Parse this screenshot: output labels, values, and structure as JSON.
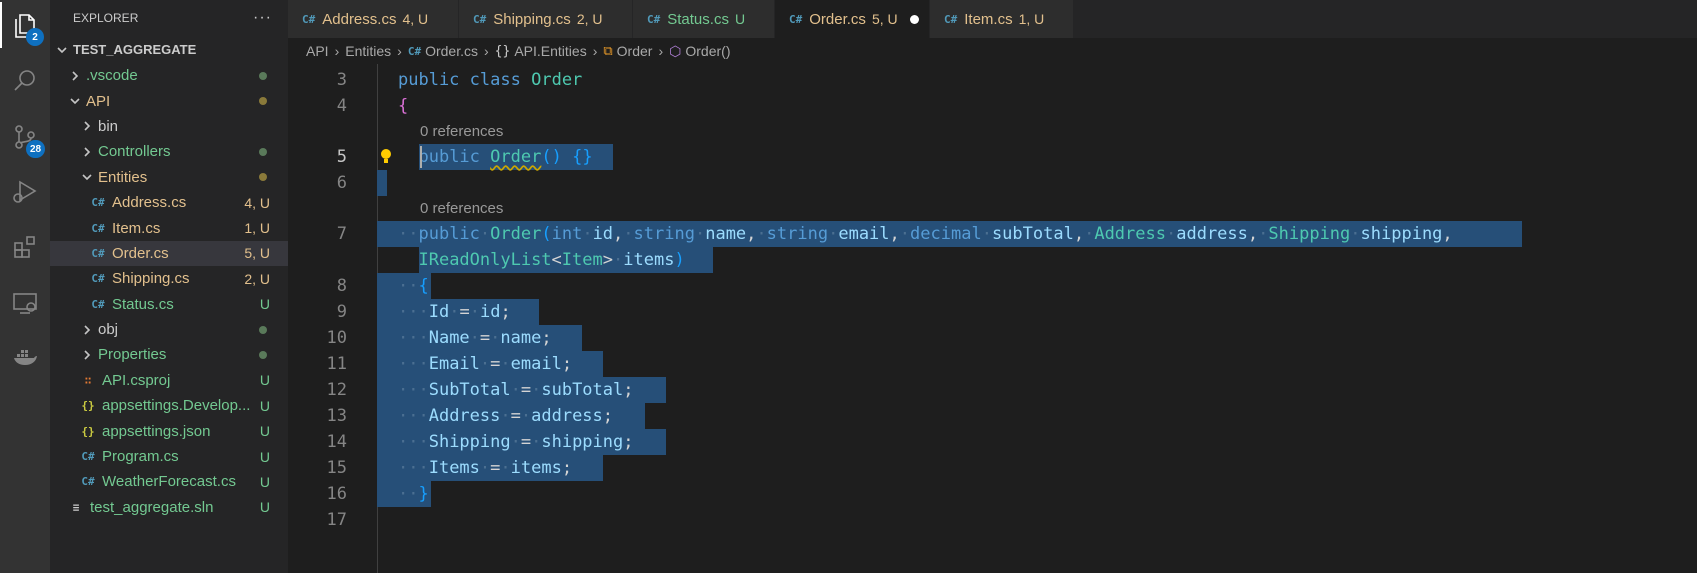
{
  "activity": {
    "explorer_badge": "2",
    "scm_badge": "28"
  },
  "sidebar": {
    "title": "EXPLORER",
    "more": "···",
    "root": "TEST_AGGREGATE",
    "items": [
      {
        "label": ".vscode",
        "kind": "folder",
        "open": false,
        "level": 1,
        "color": "#73c991",
        "marker": "dot",
        "marker_color": "#5a7a5a"
      },
      {
        "label": "API",
        "kind": "folder",
        "open": true,
        "level": 1,
        "color": "#e2c08d",
        "marker": "dot",
        "marker_color": "#8a7a3a"
      },
      {
        "label": "bin",
        "kind": "folder",
        "open": false,
        "level": 2,
        "color": "#cccccc",
        "marker": "",
        "marker_color": ""
      },
      {
        "label": "Controllers",
        "kind": "folder",
        "open": false,
        "level": 2,
        "color": "#73c991",
        "marker": "dot",
        "marker_color": "#5a7a5a"
      },
      {
        "label": "Entities",
        "kind": "folder",
        "open": true,
        "level": 2,
        "color": "#e2c08d",
        "marker": "dot",
        "marker_color": "#8a7a3a"
      },
      {
        "label": "Address.cs",
        "kind": "cs",
        "level": 3,
        "color": "#e2c08d",
        "marker": "4, U",
        "marker_color": "#e2c08d"
      },
      {
        "label": "Item.cs",
        "kind": "cs",
        "level": 3,
        "color": "#e2c08d",
        "marker": "1, U",
        "marker_color": "#e2c08d"
      },
      {
        "label": "Order.cs",
        "kind": "cs",
        "level": 3,
        "color": "#e2c08d",
        "marker": "5, U",
        "marker_color": "#e2c08d",
        "selected": true
      },
      {
        "label": "Shipping.cs",
        "kind": "cs",
        "level": 3,
        "color": "#e2c08d",
        "marker": "2, U",
        "marker_color": "#e2c08d"
      },
      {
        "label": "Status.cs",
        "kind": "cs",
        "level": 3,
        "color": "#73c991",
        "marker": "U",
        "marker_color": "#73c991"
      },
      {
        "label": "obj",
        "kind": "folder",
        "open": false,
        "level": 2,
        "color": "#cccccc",
        "marker": "dot",
        "marker_color": "#5a7a5a"
      },
      {
        "label": "Properties",
        "kind": "folder",
        "open": false,
        "level": 2,
        "color": "#73c991",
        "marker": "dot",
        "marker_color": "#5a7a5a"
      },
      {
        "label": "API.csproj",
        "kind": "rss",
        "level": 2,
        "color": "#73c991",
        "marker": "U",
        "marker_color": "#73c991"
      },
      {
        "label": "appsettings.Develop...",
        "kind": "json",
        "level": 2,
        "color": "#73c991",
        "marker": "U",
        "marker_color": "#73c991"
      },
      {
        "label": "appsettings.json",
        "kind": "json",
        "level": 2,
        "color": "#73c991",
        "marker": "U",
        "marker_color": "#73c991"
      },
      {
        "label": "Program.cs",
        "kind": "cs",
        "level": 2,
        "color": "#73c991",
        "marker": "U",
        "marker_color": "#73c991"
      },
      {
        "label": "WeatherForecast.cs",
        "kind": "cs",
        "level": 2,
        "color": "#73c991",
        "marker": "U",
        "marker_color": "#73c991"
      },
      {
        "label": "test_aggregate.sln",
        "kind": "sln",
        "level": 1,
        "color": "#73c991",
        "marker": "U",
        "marker_color": "#73c991"
      }
    ]
  },
  "tabs": [
    {
      "label": "Address.cs",
      "status": "4, U",
      "active": false
    },
    {
      "label": "Shipping.cs",
      "status": "2, U",
      "active": false
    },
    {
      "label": "Status.cs",
      "status": "U",
      "active": false,
      "green": true
    },
    {
      "label": "Order.cs",
      "status": "5, U",
      "active": true,
      "modified": true
    },
    {
      "label": "Item.cs",
      "status": "1, U",
      "active": false
    }
  ],
  "breadcrumb": {
    "api": "API",
    "entities": "Entities",
    "file": "Order.cs",
    "namespace": "API.Entities",
    "class": "Order",
    "method": "Order()"
  },
  "code": {
    "lens_1": "0 references",
    "lens_2": "0 references",
    "line_numbers": [
      "3",
      "4",
      "5",
      "6",
      "7",
      "8",
      "9",
      "10",
      "11",
      "12",
      "13",
      "14",
      "15",
      "16",
      "17"
    ]
  },
  "colors": {
    "accent": "#0e70c0",
    "selection": "#264f78",
    "modified": "#e2c08d",
    "untracked": "#73c991"
  }
}
